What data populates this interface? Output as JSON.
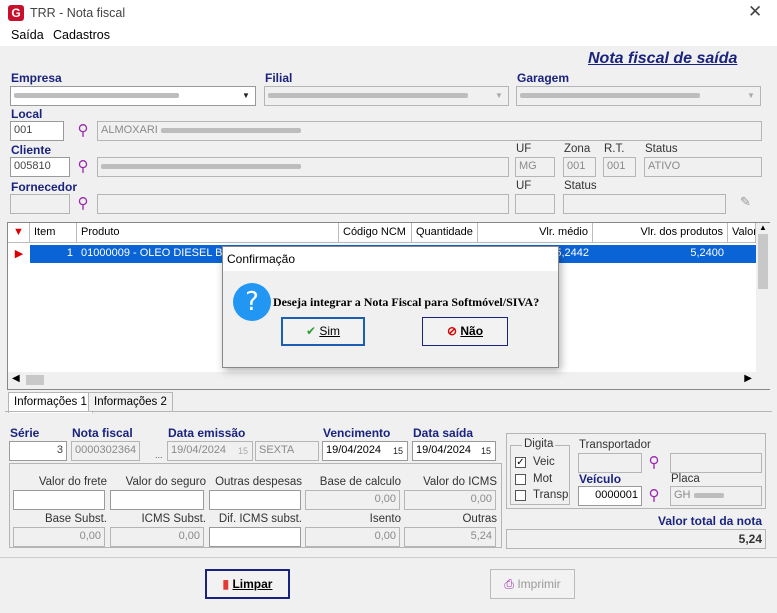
{
  "window": {
    "title": "TRR - Nota fiscal",
    "close": "✕"
  },
  "menu": [
    "Saída",
    "Cadastros"
  ],
  "header": {
    "title": "Nota fiscal de saída"
  },
  "empresa": {
    "label": "Empresa",
    "value": "",
    "filial_label": "Filial",
    "filial_value": "",
    "garagem_label": "Garagem",
    "garagem_value": ""
  },
  "local": {
    "label": "Local",
    "code": "001",
    "name": "ALMOXARI"
  },
  "cliente": {
    "label": "Cliente",
    "code": "005810",
    "uf_label": "UF",
    "uf": "MG",
    "zona_label": "Zona",
    "zona": "001",
    "rt_label": "R.T.",
    "rt": "001",
    "status_label": "Status",
    "status": "ATIVO"
  },
  "fornecedor": {
    "label": "Fornecedor",
    "uf_label": "UF",
    "status_label": "Status"
  },
  "grid": {
    "headers": [
      "Item",
      "Produto",
      "Código NCM",
      "Quantidade",
      "Vlr. médio",
      "Vlr. dos produtos",
      "Valor"
    ],
    "rows": [
      {
        "item": "1",
        "produto": "01000009 - OLEO DIESEL B S",
        "ncm": "",
        "qtd": "",
        "medio": "5,2442",
        "produtos": "5,2400",
        "valor": ""
      }
    ]
  },
  "dialog": {
    "title": "Confirmação",
    "message": "Deseja integrar a Nota Fiscal para Softmóvel/SIVA?",
    "yes": "Sim",
    "no": "Não"
  },
  "tabs": [
    "Informações 1",
    "Informações 2"
  ],
  "nota": {
    "serie_label": "Série",
    "serie": "3",
    "nota_label": "Nota fiscal",
    "nota": "0000302364",
    "emissao_label": "Data emissão",
    "emissao": "19/04/2024",
    "dia": "SEXTA",
    "venc_label": "Vencimento",
    "venc": "19/04/2024",
    "saida_label": "Data saída",
    "saida": "19/04/2024"
  },
  "valores": {
    "frete_label": "Valor do frete",
    "frete": "",
    "seguro_label": "Valor do seguro",
    "seguro": "",
    "outras_label": "Outras despesas",
    "outras": "",
    "base_label": "Base de calculo",
    "base": "0,00",
    "icms_label": "Valor do ICMS",
    "icms": "0,00",
    "bsubst_label": "Base Subst.",
    "bsubst": "0,00",
    "icmssubst_label": "ICMS Subst.",
    "icmssubst": "0,00",
    "dif_label": "Dif. ICMS subst.",
    "dif": "",
    "isento_label": "Isento",
    "isento": "0,00",
    "out_label": "Outras",
    "out": "5,24"
  },
  "digita": {
    "label": "Digita",
    "options": [
      "Veic",
      "Mot",
      "Transp"
    ],
    "checked": "Veic"
  },
  "transp": {
    "label": "Transportador",
    "veiculo_label": "Veículo",
    "veiculo": "0000001",
    "placa_label": "Placa",
    "placa": "GH"
  },
  "total": {
    "label": "Valor total da nota",
    "value": "5,24"
  },
  "footer": {
    "limpar": "Limpar",
    "imprimir": "Imprimir"
  }
}
